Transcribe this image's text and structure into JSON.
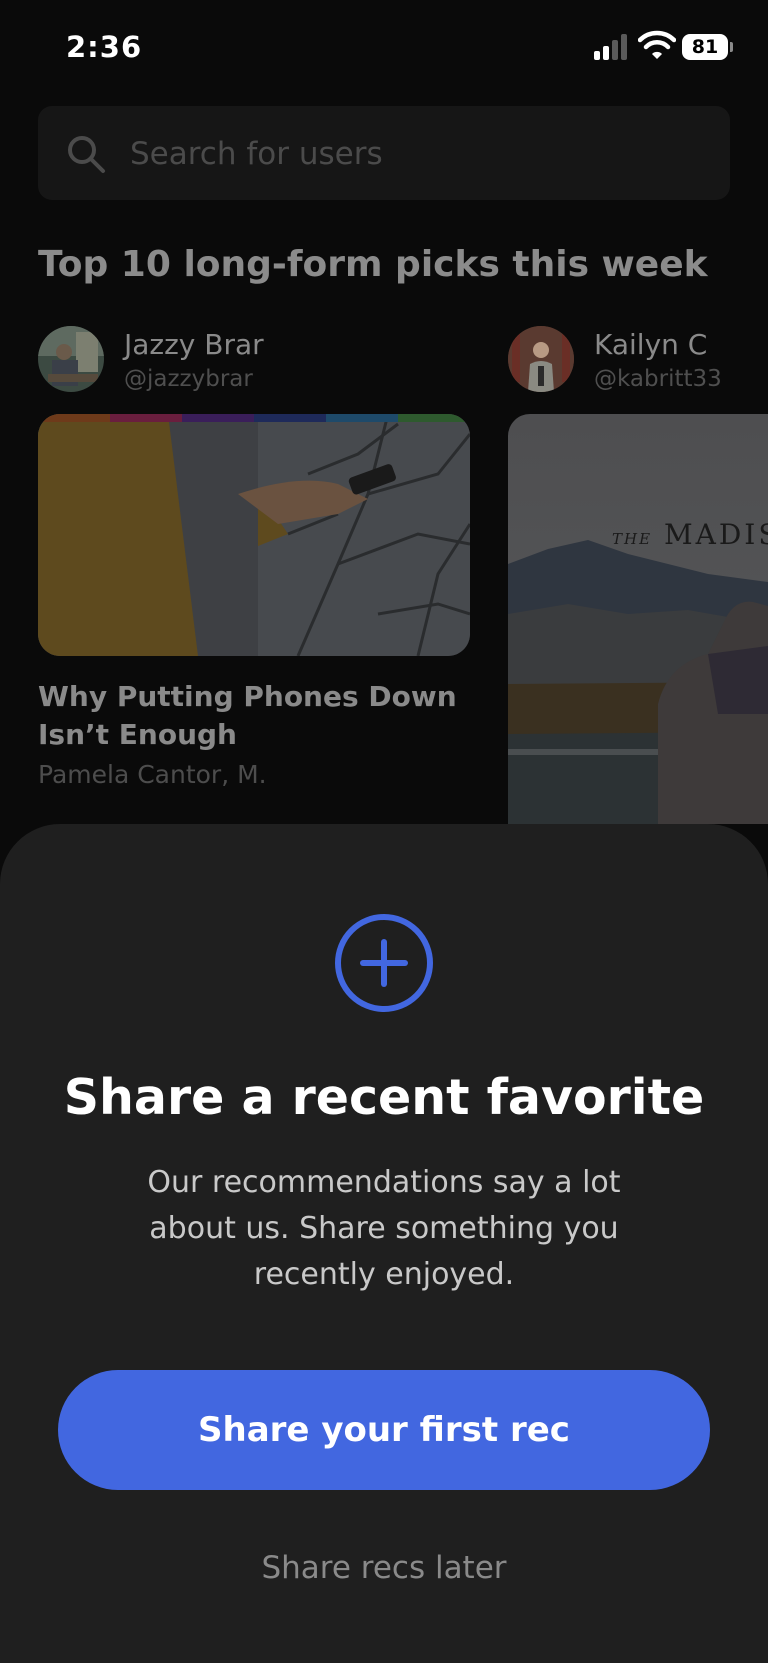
{
  "status_bar": {
    "time": "2:36",
    "battery": "81"
  },
  "search": {
    "placeholder": "Search for users"
  },
  "section": {
    "title": "Top 10 long-form picks this week"
  },
  "users": [
    {
      "name": "Jazzy Brar",
      "handle": "@jazzybrar"
    },
    {
      "name": "Kailyn C",
      "handle": "@kabritt33"
    }
  ],
  "cards": [
    {
      "title": "Why Putting Phones Down Isn’t Enough",
      "author": "Pamela Cantor, M."
    },
    {
      "poster_prefix": "THE",
      "poster_title": "MADIS"
    }
  ],
  "sheet": {
    "icon": "plus-circle-icon",
    "title": "Share a recent favorite",
    "body": "Our recommendations say a lot about us. Share something you recently enjoyed.",
    "primary_button": "Share your first rec",
    "secondary_link": "Share recs later"
  },
  "colors": {
    "accent": "#4267e0",
    "sheet_bg": "#1f1f1f",
    "page_bg": "#0a0a0a"
  }
}
